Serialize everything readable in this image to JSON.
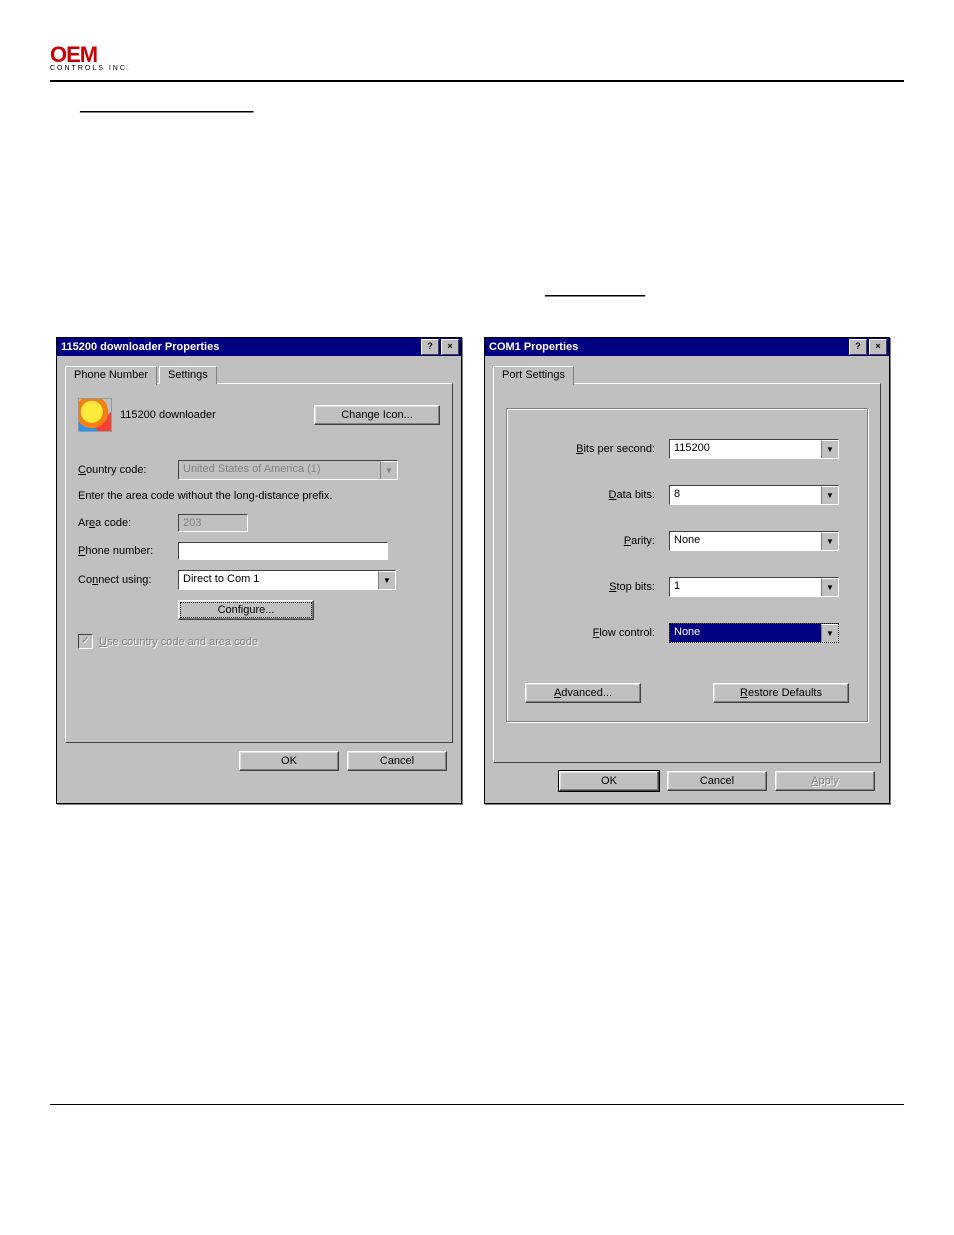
{
  "header": {
    "logo_top": "OEM",
    "logo_bottom": "CONTROLS INC."
  },
  "section_link": "________________________",
  "inline_link": "_______________",
  "dialog1": {
    "title": "115200 downloader Properties",
    "help_btn": "?",
    "close_btn": "×",
    "tabs": {
      "phone": "Phone Number",
      "settings": "Settings"
    },
    "conn_label": "115200 downloader",
    "change_icon_btn": "Change Icon...",
    "country_label": "Country code:",
    "country_value": "United States of America (1)",
    "area_hint": "Enter the area code without the long-distance prefix.",
    "area_label": "Area code:",
    "area_value": "203",
    "phone_label": "Phone number:",
    "phone_value": "",
    "connect_label": "Connect using:",
    "connect_value": "Direct to Com 1",
    "configure_btn": "Configure...",
    "use_country_chk": "Use country code and area code",
    "ok_btn": "OK",
    "cancel_btn": "Cancel"
  },
  "dialog2": {
    "title": "COM1 Properties",
    "help_btn": "?",
    "close_btn": "×",
    "tab_port": "Port Settings",
    "bits_label": "Bits per second:",
    "bits_value": "115200",
    "data_label": "Data bits:",
    "data_value": "8",
    "parity_label": "Parity:",
    "parity_value": "None",
    "stop_label": "Stop bits:",
    "stop_value": "1",
    "flow_label": "Flow control:",
    "flow_value": "None",
    "advanced_btn": "Advanced...",
    "restore_btn": "Restore Defaults",
    "ok_btn": "OK",
    "cancel_btn": "Cancel",
    "apply_btn": "Apply"
  }
}
